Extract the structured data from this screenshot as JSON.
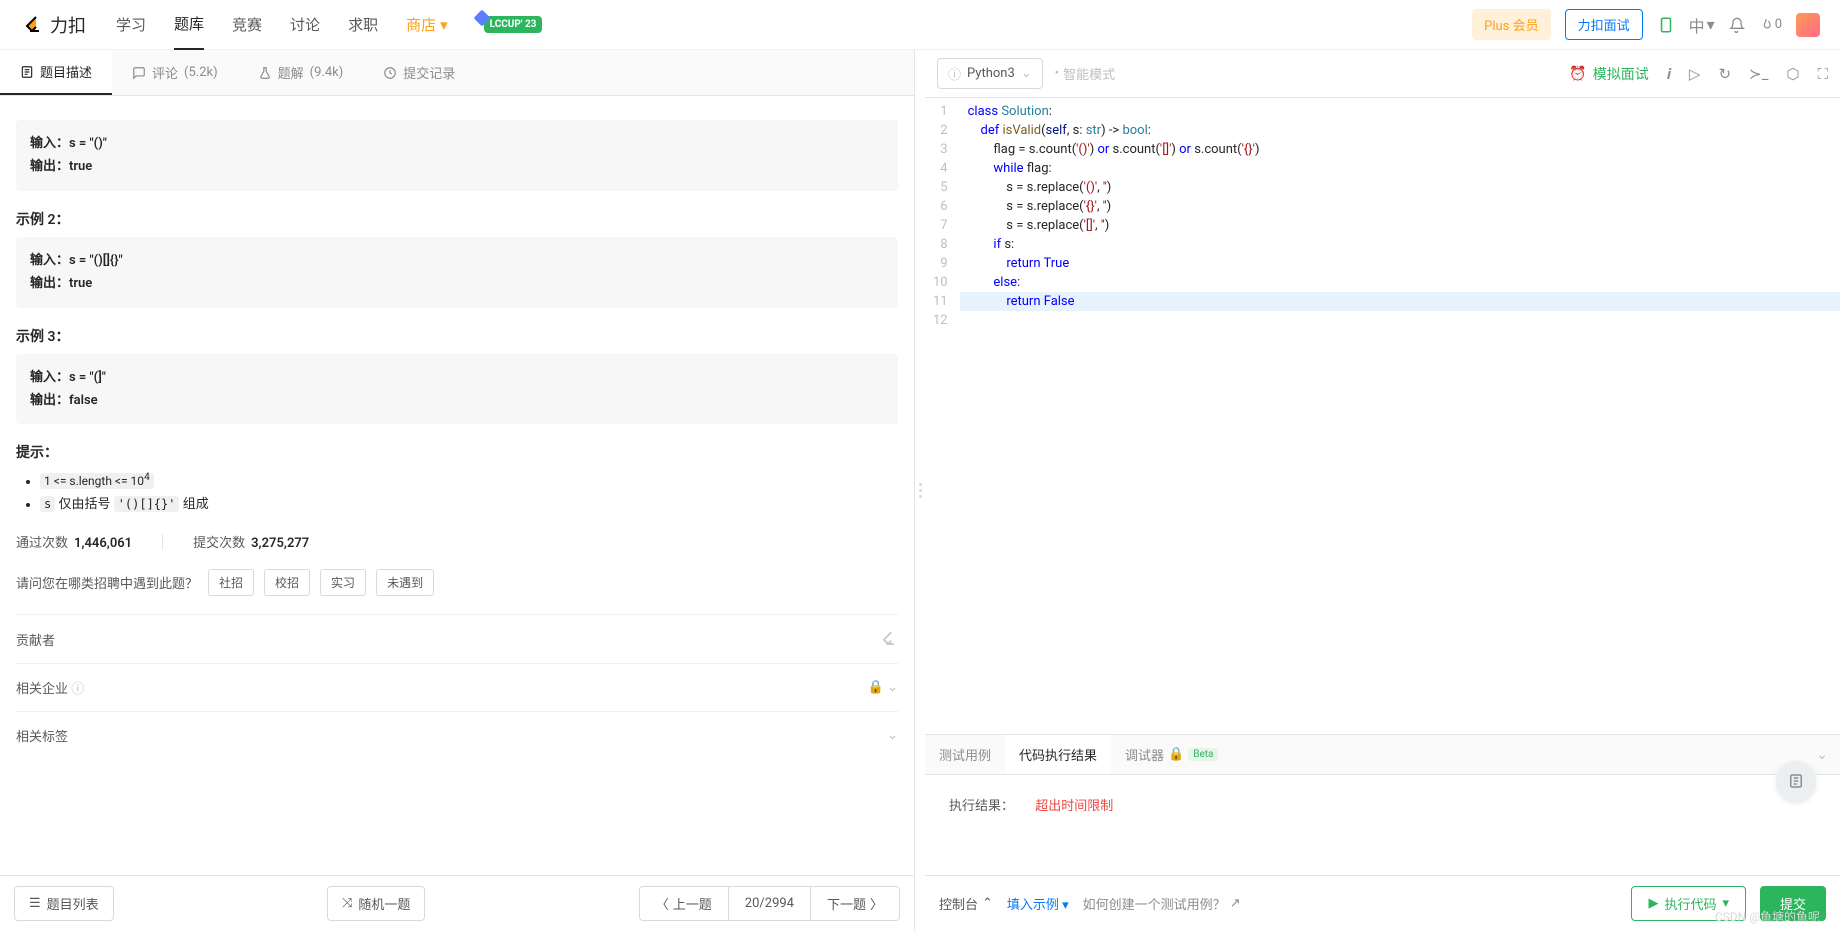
{
  "brand": "力扣",
  "nav": {
    "study": "学习",
    "problems": "题库",
    "contest": "竞赛",
    "discuss": "讨论",
    "jobs": "求职",
    "store": "商店",
    "lccup": "LCCUP' 23"
  },
  "topRight": {
    "plus": "Plus 会员",
    "interview": "力扣面试",
    "lang": "中",
    "fire": "0"
  },
  "tabs": {
    "desc": "题目描述",
    "comments": "评论",
    "commentsCount": "(5.2k)",
    "solutions": "题解",
    "solutionsCount": "(9.4k)",
    "submissions": "提交记录"
  },
  "desc": {
    "ex1_in": "输入：s = \"()\"",
    "ex1_out": "输出：true",
    "ex2_title": "示例 2：",
    "ex2_in": "输入：s = \"()[]{}\"",
    "ex2_out": "输出：true",
    "ex3_title": "示例 3：",
    "ex3_in": "输入：s = \"(]\"",
    "ex3_out": "输出：false",
    "hints_title": "提示：",
    "hint1_pre": "1 <= s.length <= 10",
    "hint1_sup": "4",
    "hint2_a": "s",
    "hint2_b": " 仅由括号 ",
    "hint2_c": "'()[]{}'",
    "hint2_d": " 组成",
    "passLabel": "通过次数",
    "passVal": "1,446,061",
    "submitLabel": "提交次数",
    "submitVal": "3,275,277",
    "surveyQ": "请问您在哪类招聘中遇到此题？",
    "surveyBtns": [
      "社招",
      "校招",
      "实习",
      "未遇到"
    ],
    "contrib": "贡献者",
    "companies": "相关企业",
    "tags": "相关标签"
  },
  "bottom": {
    "list": "题目列表",
    "random": "随机一题",
    "prev": "上一题",
    "counter": "20/2994",
    "next": "下一题"
  },
  "editor": {
    "lang": "Python3",
    "smart": "智能模式",
    "mock": "模拟面试",
    "lines": [
      "1",
      "2",
      "3",
      "4",
      "5",
      "6",
      "7",
      "8",
      "9",
      "10",
      "11",
      "12"
    ]
  },
  "console": {
    "tabs": {
      "testcase": "测试用例",
      "result": "代码执行结果",
      "debugger": "调试器",
      "beta": "Beta"
    },
    "resultLabel": "执行结果：",
    "resultValue": "超出时间限制",
    "toggle": "控制台",
    "fill": "填入示例",
    "help": "如何创建一个测试用例？",
    "run": "执行代码",
    "submit": "提交"
  },
  "watermark": "CSDN @鱼塘的鱼呢"
}
